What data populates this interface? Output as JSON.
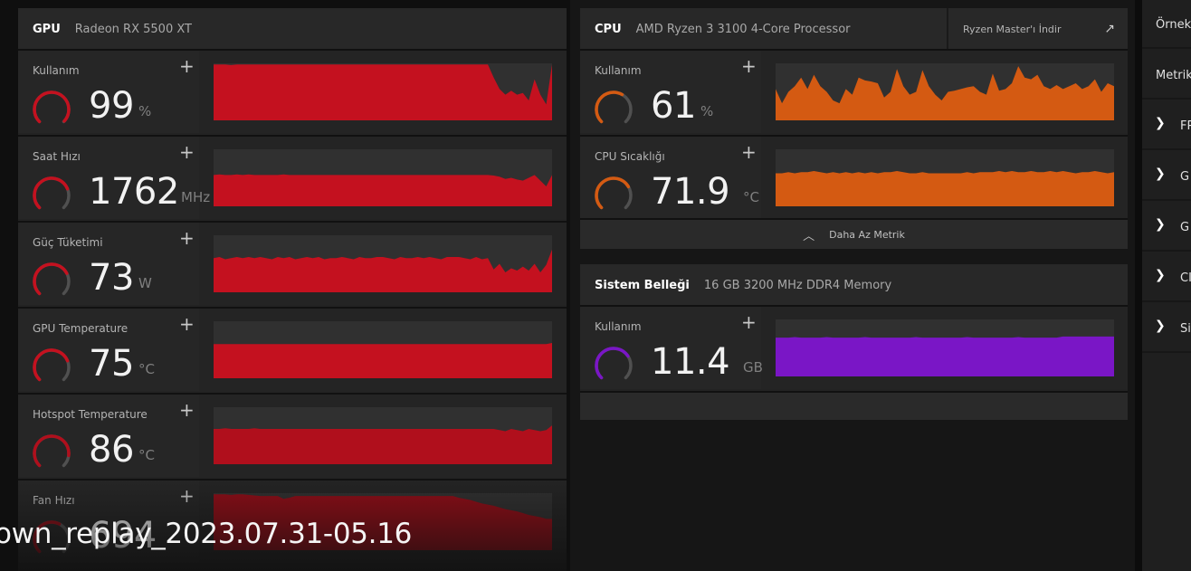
{
  "gpu": {
    "title": "GPU",
    "model": "Radeon RX 5500 XT",
    "metrics": [
      {
        "label": "Kullanım",
        "value": "99",
        "unit": "%",
        "gauge": 0.99,
        "color": "#c4111f",
        "series": [
          0.98,
          0.98,
          0.98,
          0.97,
          0.98,
          0.98,
          0.98,
          0.98,
          0.98,
          0.98,
          0.98,
          0.98,
          0.98,
          0.98,
          0.98,
          0.98,
          0.98,
          0.98,
          0.98,
          0.98,
          0.98,
          0.98,
          0.98,
          0.98,
          0.98,
          0.98,
          0.98,
          0.98,
          0.98,
          0.98,
          0.98,
          0.98,
          0.98,
          0.98,
          0.98,
          0.98,
          0.98,
          0.98,
          0.98,
          0.98,
          0.98,
          0.98,
          0.98,
          0.98,
          0.98,
          0.98,
          0.98,
          0.98,
          0.75,
          0.55,
          0.45,
          0.52,
          0.45,
          0.48,
          0.35,
          0.72,
          0.45,
          0.28,
          0.98
        ]
      },
      {
        "label": "Saat Hızı",
        "value": "1762",
        "unit": "MHz",
        "gauge": 0.75,
        "color": "#c4111f",
        "series": [
          0.55,
          0.56,
          0.55,
          0.55,
          0.56,
          0.55,
          0.56,
          0.55,
          0.55,
          0.55,
          0.55,
          0.55,
          0.56,
          0.55,
          0.55,
          0.55,
          0.55,
          0.55,
          0.55,
          0.55,
          0.55,
          0.55,
          0.55,
          0.55,
          0.55,
          0.55,
          0.55,
          0.55,
          0.55,
          0.55,
          0.55,
          0.55,
          0.55,
          0.55,
          0.55,
          0.55,
          0.55,
          0.55,
          0.55,
          0.55,
          0.55,
          0.55,
          0.55,
          0.55,
          0.55,
          0.55,
          0.55,
          0.55,
          0.54,
          0.52,
          0.48,
          0.5,
          0.47,
          0.45,
          0.5,
          0.55,
          0.45,
          0.35,
          0.55
        ]
      },
      {
        "label": "Güç Tüketimi",
        "value": "73",
        "unit": "W",
        "gauge": 0.73,
        "color": "#c4111f",
        "series": [
          0.6,
          0.62,
          0.58,
          0.6,
          0.62,
          0.6,
          0.62,
          0.6,
          0.62,
          0.6,
          0.58,
          0.62,
          0.6,
          0.62,
          0.58,
          0.6,
          0.62,
          0.6,
          0.62,
          0.58,
          0.6,
          0.6,
          0.62,
          0.6,
          0.58,
          0.62,
          0.6,
          0.6,
          0.62,
          0.62,
          0.6,
          0.58,
          0.62,
          0.6,
          0.6,
          0.62,
          0.6,
          0.62,
          0.6,
          0.58,
          0.62,
          0.62,
          0.62,
          0.6,
          0.58,
          0.62,
          0.58,
          0.6,
          0.4,
          0.5,
          0.35,
          0.42,
          0.38,
          0.45,
          0.38,
          0.5,
          0.35,
          0.48,
          0.75
        ]
      },
      {
        "label": "GPU Temperature",
        "value": "75",
        "unit": "°C",
        "gauge": 0.75,
        "color": "#c4111f",
        "series": [
          0.6,
          0.6,
          0.6,
          0.6,
          0.6,
          0.6,
          0.6,
          0.6,
          0.6,
          0.6,
          0.6,
          0.6,
          0.6,
          0.6,
          0.6,
          0.6,
          0.6,
          0.6,
          0.6,
          0.6,
          0.6,
          0.6,
          0.6,
          0.6,
          0.6,
          0.6,
          0.6,
          0.6,
          0.6,
          0.6,
          0.6,
          0.6,
          0.6,
          0.6,
          0.6,
          0.6,
          0.6,
          0.6,
          0.6,
          0.6,
          0.6,
          0.6,
          0.6,
          0.6,
          0.6,
          0.6,
          0.6,
          0.6,
          0.6,
          0.6,
          0.6,
          0.6,
          0.6,
          0.6,
          0.6,
          0.6,
          0.6,
          0.6,
          0.62
        ]
      },
      {
        "label": "Hotspot Temperature",
        "value": "86",
        "unit": "°C",
        "gauge": 0.86,
        "color": "#b00f1c",
        "series": [
          0.62,
          0.62,
          0.63,
          0.62,
          0.62,
          0.62,
          0.62,
          0.63,
          0.62,
          0.62,
          0.62,
          0.62,
          0.62,
          0.62,
          0.62,
          0.62,
          0.62,
          0.62,
          0.62,
          0.62,
          0.62,
          0.62,
          0.62,
          0.62,
          0.62,
          0.62,
          0.62,
          0.62,
          0.62,
          0.62,
          0.62,
          0.62,
          0.62,
          0.62,
          0.62,
          0.62,
          0.62,
          0.62,
          0.62,
          0.62,
          0.62,
          0.62,
          0.62,
          0.62,
          0.62,
          0.62,
          0.62,
          0.62,
          0.62,
          0.6,
          0.58,
          0.62,
          0.6,
          0.58,
          0.62,
          0.6,
          0.58,
          0.6,
          0.68
        ]
      },
      {
        "label": "Fan Hızı",
        "value": "694",
        "unit": "",
        "gauge": 0.6,
        "color": "#8e0d17",
        "series": [
          0.98,
          0.98,
          0.98,
          0.97,
          0.98,
          0.98,
          0.97,
          0.96,
          0.95,
          0.95,
          0.95,
          0.95,
          0.9,
          0.92,
          0.95,
          0.95,
          0.95,
          0.95,
          0.95,
          0.95,
          0.95,
          0.95,
          0.95,
          0.95,
          0.95,
          0.95,
          0.95,
          0.95,
          0.95,
          0.95,
          0.95,
          0.95,
          0.95,
          0.95,
          0.95,
          0.95,
          0.95,
          0.95,
          0.95,
          0.95,
          0.95,
          0.95,
          0.92,
          0.9,
          0.88,
          0.85,
          0.82,
          0.8,
          0.78,
          0.75,
          0.72,
          0.7,
          0.68,
          0.65,
          0.62,
          0.6,
          0.58,
          0.55,
          0.55
        ]
      }
    ]
  },
  "cpu": {
    "title": "CPU",
    "model": "AMD Ryzen 3 3100 4-Core Processor",
    "ryzen_master_label": "Ryzen Master'ı İndir",
    "metrics": [
      {
        "label": "Kullanım",
        "value": "61",
        "unit": "%",
        "gauge": 0.61,
        "color": "#d45a12",
        "series": [
          0.55,
          0.3,
          0.5,
          0.6,
          0.75,
          0.55,
          0.8,
          0.6,
          0.5,
          0.35,
          0.3,
          0.55,
          0.45,
          0.75,
          0.7,
          0.68,
          0.65,
          0.4,
          0.5,
          0.9,
          0.6,
          0.45,
          0.5,
          0.88,
          0.6,
          0.45,
          0.35,
          0.5,
          0.52,
          0.55,
          0.58,
          0.6,
          0.5,
          0.45,
          0.82,
          0.52,
          0.55,
          0.65,
          0.95,
          0.75,
          0.72,
          0.8,
          0.6,
          0.55,
          0.62,
          0.55,
          0.6,
          0.65,
          0.55,
          0.6,
          0.72,
          0.5,
          0.65,
          0.6
        ]
      },
      {
        "label": "CPU Sıcaklığı",
        "value": "71.9",
        "unit": "°C",
        "gauge": 0.72,
        "color": "#d45a12",
        "series": [
          0.58,
          0.58,
          0.6,
          0.58,
          0.6,
          0.6,
          0.62,
          0.6,
          0.58,
          0.6,
          0.58,
          0.6,
          0.58,
          0.6,
          0.58,
          0.6,
          0.58,
          0.6,
          0.6,
          0.62,
          0.6,
          0.58,
          0.58,
          0.6,
          0.58,
          0.58,
          0.58,
          0.58,
          0.58,
          0.58,
          0.6,
          0.58,
          0.6,
          0.6,
          0.6,
          0.62,
          0.6,
          0.62,
          0.6,
          0.6,
          0.62,
          0.6,
          0.6,
          0.62,
          0.6,
          0.62,
          0.6,
          0.58,
          0.6,
          0.6,
          0.62,
          0.6,
          0.58,
          0.6
        ]
      }
    ],
    "less_metrics_label": "Daha Az Metrik"
  },
  "memory": {
    "title": "Sistem Belleği",
    "model": "16 GB 3200 MHz DDR4 Memory",
    "metrics": [
      {
        "label": "Kullanım",
        "value": "11.4",
        "unit": "GB",
        "gauge": 0.71,
        "color": "#7a16c6",
        "series": [
          0.68,
          0.68,
          0.68,
          0.69,
          0.68,
          0.68,
          0.68,
          0.68,
          0.69,
          0.68,
          0.68,
          0.68,
          0.68,
          0.68,
          0.69,
          0.68,
          0.68,
          0.68,
          0.68,
          0.68,
          0.68,
          0.68,
          0.69,
          0.68,
          0.68,
          0.68,
          0.68,
          0.68,
          0.68,
          0.68,
          0.69,
          0.68,
          0.68,
          0.68,
          0.68,
          0.68,
          0.68,
          0.68,
          0.69,
          0.68,
          0.68,
          0.68,
          0.68,
          0.68,
          0.68,
          0.7,
          0.7,
          0.7,
          0.7,
          0.7,
          0.7,
          0.7,
          0.7,
          0.7
        ]
      }
    ]
  },
  "right_menu": {
    "items": [
      {
        "label": "Örnekl",
        "has_chevron": false
      },
      {
        "label": "Metrik",
        "has_chevron": false
      },
      {
        "label": "FP",
        "has_chevron": true
      },
      {
        "label": "G",
        "has_chevron": true
      },
      {
        "label": "G",
        "has_chevron": true
      },
      {
        "label": "CI",
        "has_chevron": true
      },
      {
        "label": "Si",
        "has_chevron": true
      }
    ]
  },
  "overlay": {
    "replay_text": "own_replay_2023.07.31-05.16"
  },
  "icons": {
    "plus": "+",
    "chevron_right": "❯",
    "chevron_up": "︿",
    "external_link": "↗"
  }
}
